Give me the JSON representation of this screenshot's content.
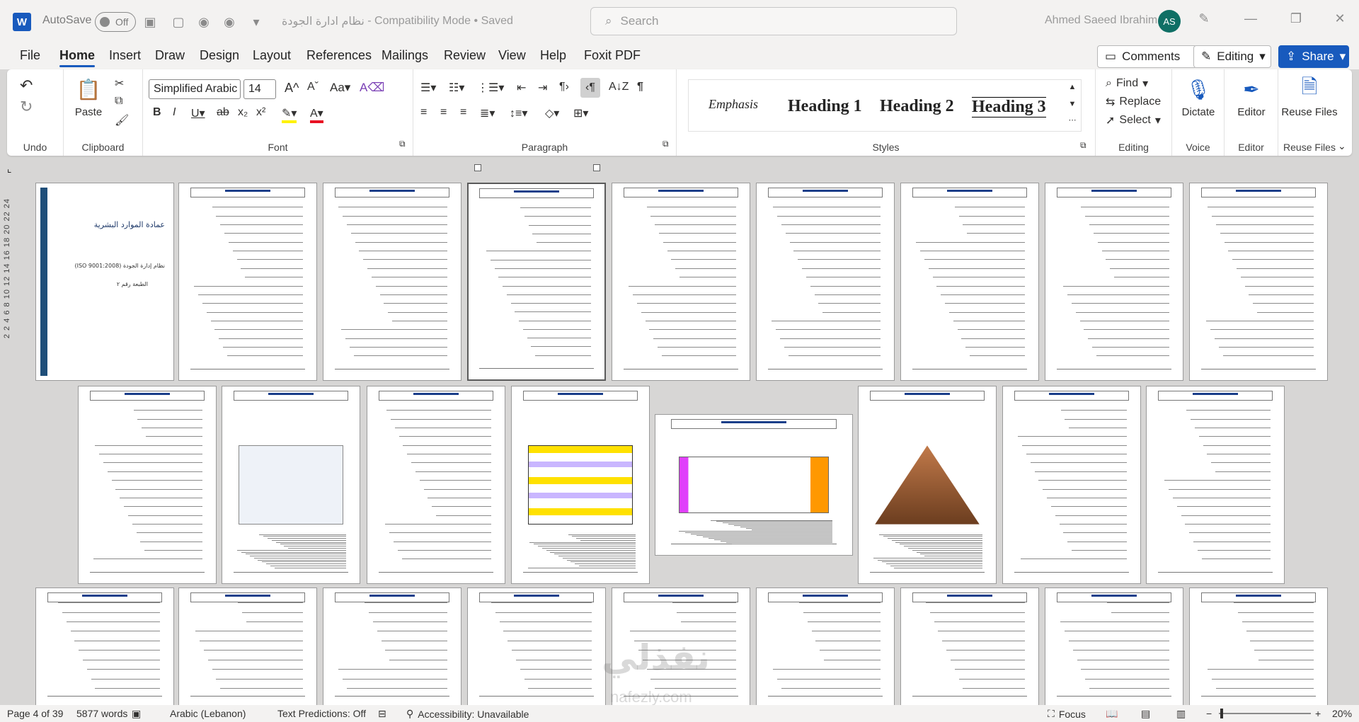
{
  "titlebar": {
    "autosave_label": "AutoSave",
    "autosave_state": "Off",
    "doc_name": "نظام ادارة الجودة",
    "doc_mode": "Compatibility Mode",
    "doc_saved": "Saved",
    "search_placeholder": "Search",
    "user_name": "Ahmed Saeed Ibrahim",
    "user_initials": "AS"
  },
  "menu": {
    "tabs": [
      "File",
      "Home",
      "Insert",
      "Draw",
      "Design",
      "Layout",
      "References",
      "Mailings",
      "Review",
      "View",
      "Help",
      "Foxit PDF"
    ],
    "comments": "Comments",
    "editing": "Editing",
    "share": "Share"
  },
  "ribbon": {
    "groups": {
      "undo": "Undo",
      "clipboard": "Clipboard",
      "font": "Font",
      "paragraph": "Paragraph",
      "styles": "Styles",
      "editing": "Editing",
      "voice": "Voice",
      "editor": "Editor",
      "reuse": "Reuse Files"
    },
    "paste": "Paste",
    "font_name": "Simplified Arabic",
    "font_size": "14",
    "styles": [
      "Emphasis",
      "Heading 1",
      "Heading 2",
      "Heading 3"
    ],
    "find": "Find",
    "replace": "Replace",
    "select": "Select",
    "dictate": "Dictate",
    "editor": "Editor",
    "reuse_files": "Reuse Files"
  },
  "cover": {
    "title": "عمادة الموارد البشرية",
    "subtitle": "نظام إدارة الجودة (ISO 9001:2008)",
    "edition": "الطبعة رقم ٢"
  },
  "vertical_ruler": "2 2 4 6 8 10 12 14 16 18 20 22 24",
  "status": {
    "page": "Page 4 of 39",
    "words": "5877 words",
    "language": "Arabic (Lebanon)",
    "predictions": "Text Predictions: Off",
    "accessibility": "Accessibility: Unavailable",
    "focus": "Focus",
    "zoom": "20%"
  },
  "watermark": {
    "text": "نفذلي",
    "url": "nafezly.com"
  },
  "colors": {
    "accent": "#185abd",
    "avatar": "#0f6f65"
  }
}
